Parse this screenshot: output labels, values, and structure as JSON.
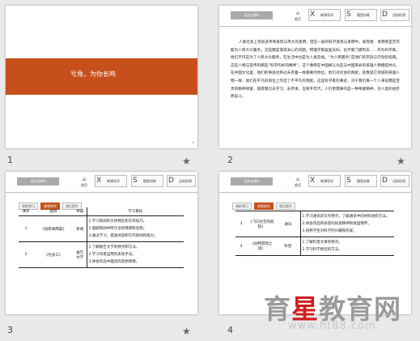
{
  "slides": [
    {
      "number": "1",
      "title": "号角，为你长鸣",
      "corner_mark": "+"
    },
    {
      "number": "2",
      "header_title": "语文必修4",
      "home_label": "首页",
      "tabs": [
        {
          "letter": "X",
          "label": "新课导学"
        },
        {
          "letter": "S",
          "label": "随堂训练"
        },
        {
          "letter": "D",
          "label": "达标检测"
        }
      ],
      "paragraph": "人类社会上有很多传奇发现与伟大的发明，但在一般的科学发现与发明中，发现者、发明者是否可能为人民大众服务，这些都是值得关心的问题。物理学家居里夫妇、化学家门捷列夫……作为科学家，他们不仅是为了人民大众服务，在生活中也是为人类造福。“为人民服务”是他们的宗旨与行动的指南。这些人物与宣传的那些“科学的好的精神”，这个事例在中国被认为是与中国革命的英雄人物相提并论，在中国文化里，他们的事迹也和过去有着一样重要的地位。他们对社会的贡献，就像其它领域的英雄人物一样，他们在平凡的岗位上作出了不平凡的贡献。这些科学家的事迹，对于我们每一个人来说都是宝贵的精神财富，值得我们去学习，去传承。在和平年代，人们更需要的是一种奉献精神，为人类的进步而奋斗。"
    },
    {
      "number": "3",
      "header_title": "语文必修4",
      "home_label": "首页",
      "tabs": [
        {
          "letter": "X",
          "label": "新课导学"
        },
        {
          "letter": "S",
          "label": "随堂训练"
        },
        {
          "letter": "D",
          "label": "达标检测"
        }
      ],
      "tags": [
        "课前预习",
        "课堂探究",
        "课后提升"
      ],
      "table": {
        "headers": [
          "课序",
          "题目",
          "体裁",
          "学习目标"
        ],
        "rows": [
          {
            "seq": "1",
            "topic": "《短新闻两篇》",
            "genre": "新闻",
            "goal": "1.学习新闻的文体特征和写作技巧。\n2.理解新闻中所包含的情感和思想。\n3.通过学习，提高阅读和写作新闻的能力。"
          },
          {
            "seq": "2",
            "topic": "《包身工》",
            "genre": "报告文学",
            "goal": "1.了解报告文学的特点和写法。\n2.学习作者运用的表现手法。\n3.体会作品中蕴含的思想感情。"
          }
        ]
      }
    },
    {
      "number": "4",
      "header_title": "语文必修4",
      "home_label": "首页",
      "tabs": [
        {
          "letter": "X",
          "label": "新课导学"
        },
        {
          "letter": "S",
          "label": "随堂训练"
        },
        {
          "letter": "D",
          "label": "达标检测"
        }
      ],
      "tags": [
        "课前预习",
        "课堂探究",
        "课后提升"
      ],
      "table": {
        "rows": [
          {
            "seq": "3",
            "topic": "《飞向太空的航程》",
            "genre": "通讯",
            "goal": "1.学习通讯的写作特点，了解通讯中的材料组织方法。\n2.体会作品所表现的民族精神和爱国情怀。\n3.培养学生对科学的兴趣和热爱。"
          },
          {
            "seq": "4",
            "topic": "《动物游戏之谜》",
            "genre": "科普",
            "goal": "1.了解科普文章的特点。\n2.学习科学探究的方法。"
          }
        ]
      }
    }
  ],
  "watermark": {
    "text_before": "育",
    "text_star": "星",
    "text_after": "教育网",
    "url": "www.ht88.com"
  }
}
